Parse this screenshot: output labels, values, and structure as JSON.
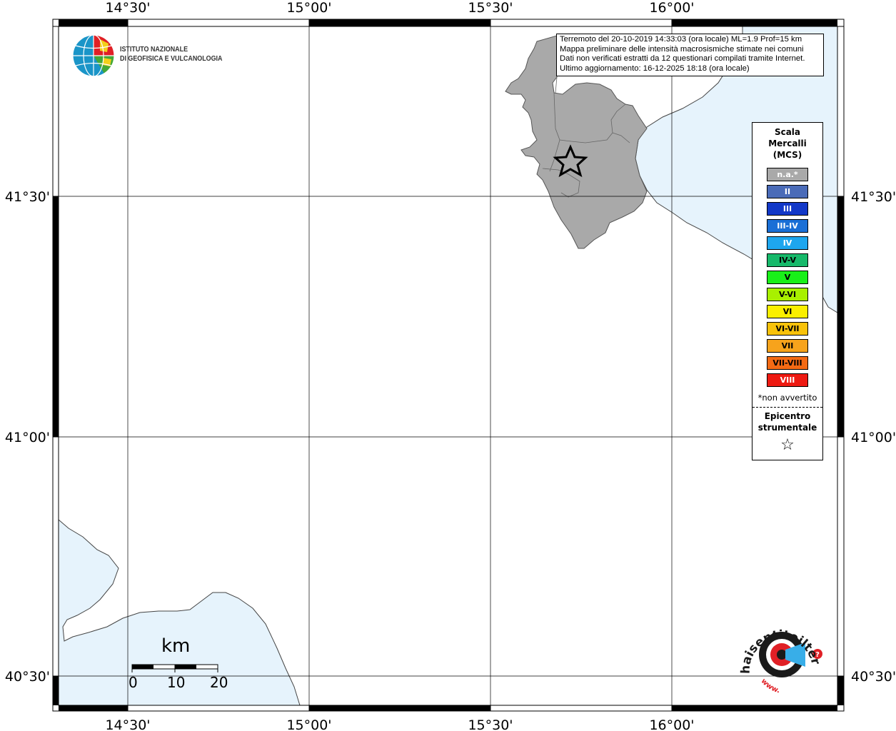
{
  "map": {
    "lon_ticks_top": [
      "14°30'",
      "15°00'",
      "15°30'",
      "16°00'"
    ],
    "lon_ticks_bottom": [
      "14°30'",
      "15°00'",
      "15°30'",
      "16°00'"
    ],
    "lat_ticks_left": [
      "41°30'",
      "41°00'",
      "40°30'"
    ],
    "lat_ticks_right": [
      "41°30'",
      "41°00'",
      "40°30'"
    ],
    "colors": {
      "land": "#ffffff",
      "sea": "#e6f3fc",
      "affected_area": "#a9a9a9",
      "border": "#000000"
    }
  },
  "logo": {
    "line1": "ISTITUTO NAZIONALE",
    "line2": "DI GEOFISICA E VULCANOLOGIA"
  },
  "info": {
    "line1": "Terremoto del 20-10-2019 14:33:03 (ora locale) ML=1.9 Prof=15 km",
    "line2": "Mappa preliminare delle intensità macrosismiche stimate nei comuni",
    "line3": "Dati non verificati estratti da 12 questionari compilati tramite Internet.",
    "line4": "Ultimo aggiornamento: 16-12-2025 18:18 (ora locale)"
  },
  "legend": {
    "title1": "Scala",
    "title2": "Mercalli",
    "title3": "(MCS)",
    "items": [
      {
        "label": "n.a.*",
        "color": "#a9a9a9",
        "text_color": "#ffffff"
      },
      {
        "label": "II",
        "color": "#4a6bb8",
        "text_color": "#ffffff"
      },
      {
        "label": "III",
        "color": "#1238c8",
        "text_color": "#ffffff"
      },
      {
        "label": "III-IV",
        "color": "#1a6fd6",
        "text_color": "#ffffff"
      },
      {
        "label": "IV",
        "color": "#1ea6ee",
        "text_color": "#ffffff"
      },
      {
        "label": "IV-V",
        "color": "#17b96a",
        "text_color": "#000000"
      },
      {
        "label": "V",
        "color": "#19ef19",
        "text_color": "#000000"
      },
      {
        "label": "V-VI",
        "color": "#a8f000",
        "text_color": "#000000"
      },
      {
        "label": "VI",
        "color": "#fbef00",
        "text_color": "#000000"
      },
      {
        "label": "VI-VII",
        "color": "#f8c20a",
        "text_color": "#000000"
      },
      {
        "label": "VII",
        "color": "#f7a31c",
        "text_color": "#000000"
      },
      {
        "label": "VII-VIII",
        "color": "#f46a14",
        "text_color": "#000000"
      },
      {
        "label": "VIII",
        "color": "#ee1a12",
        "text_color": "#ffffff"
      }
    ],
    "note": "*non avvertito",
    "epicenter1": "Epicentro",
    "epicenter2": "strumentale",
    "star": "☆"
  },
  "scale_bar": {
    "title": "km",
    "labels": [
      "0",
      "10",
      "20"
    ]
  },
  "hst_logo": {
    "text": "haisentitoilterremoto.it",
    "url_prefix": "www."
  }
}
